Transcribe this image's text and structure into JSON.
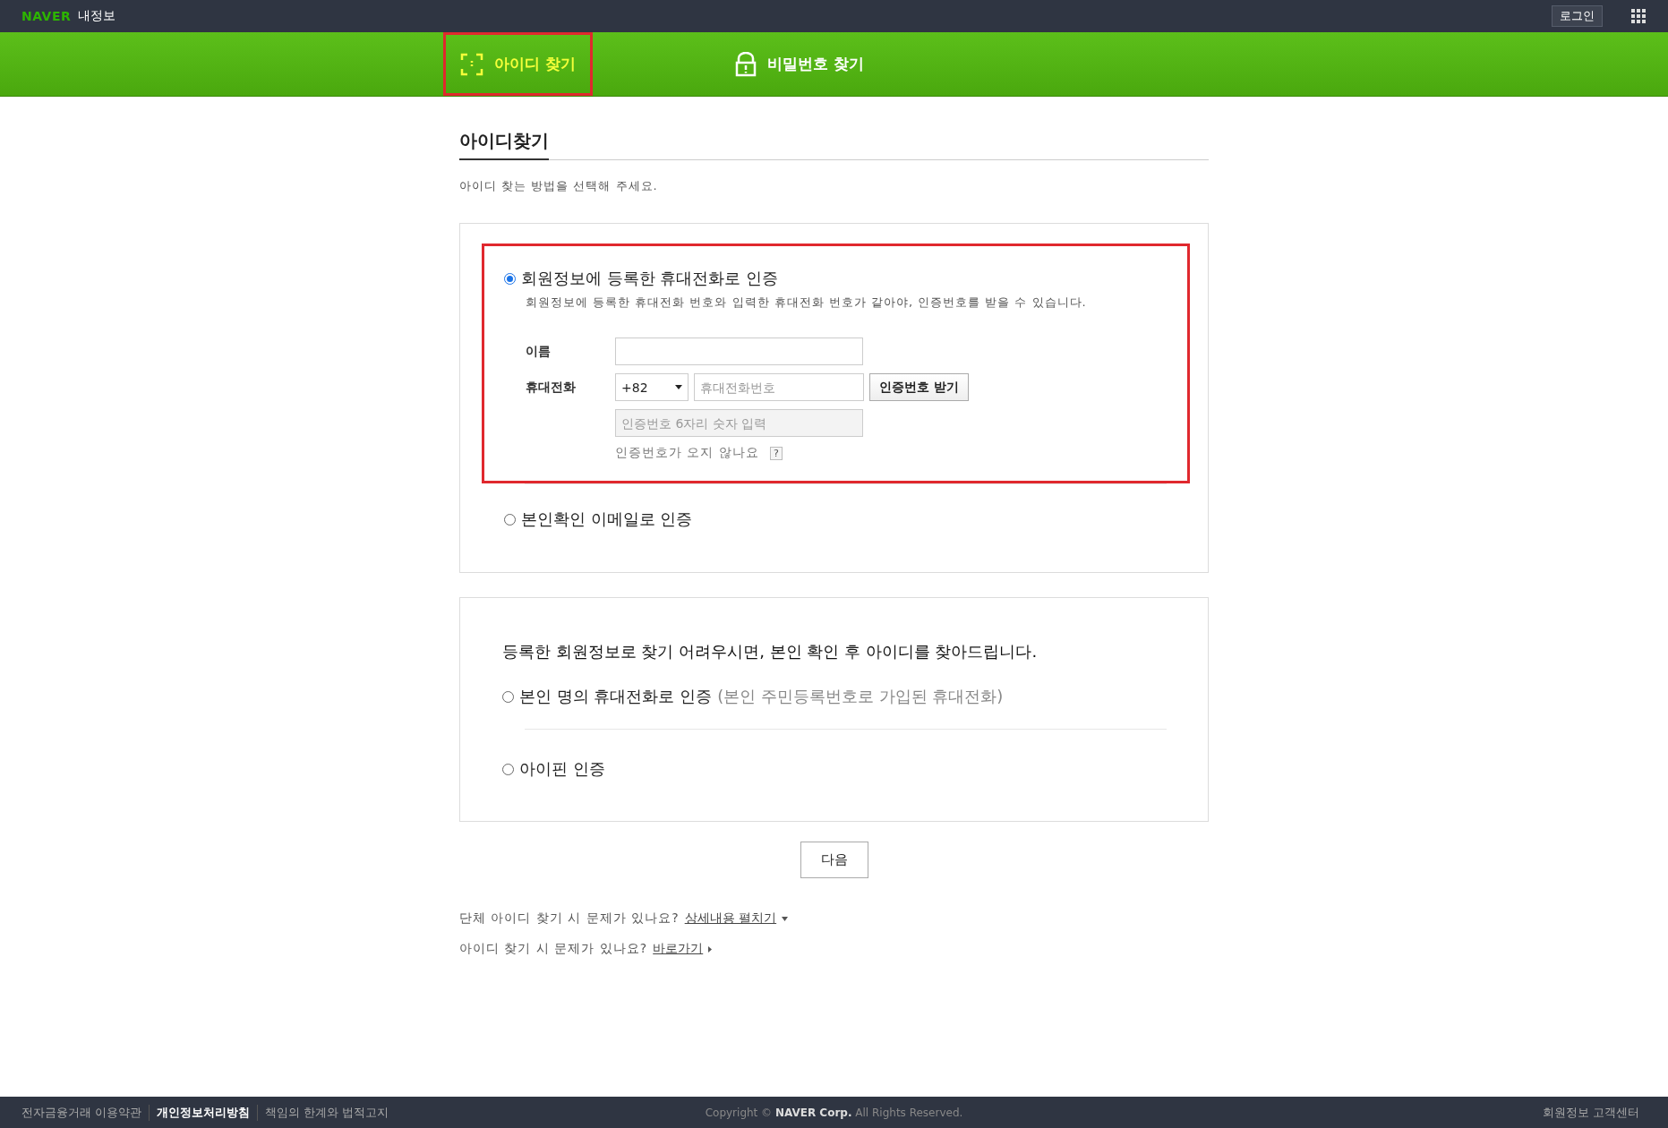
{
  "top_bar": {
    "logo": "NAVER",
    "service": "내정보",
    "login_button": "로그인"
  },
  "nav_tabs": [
    {
      "label": "아이디 찾기",
      "kind": "id",
      "selected": true,
      "highlighted": true
    },
    {
      "label": "비밀번호 찾기",
      "kind": "password",
      "selected": false,
      "highlighted": false
    }
  ],
  "page_title": "아이디찾기",
  "instruction": "아이디 찾는 방법을 선택해 주세요.",
  "primary_options": [
    {
      "label": "회원정보에 등록한 휴대전화로 인증",
      "selected": true,
      "highlighted": true,
      "description": "회원정보에 등록한 휴대전화 번호와 입력한 휴대전화 번호가 같아야, 인증번호를 받을 수 있습니다.",
      "form": {
        "name_label": "이름",
        "phone_label": "휴대전화",
        "country_code": "+82",
        "phone_placeholder": "휴대전화번호",
        "send_code_button": "인증번호 받기",
        "code_placeholder": "인증번호 6자리 숫자 입력",
        "no_code_help": "인증번호가 오지 않나요",
        "help_button": "?"
      }
    },
    {
      "label": "본인확인 이메일로 인증",
      "selected": false,
      "highlighted": false
    }
  ],
  "alternative": {
    "heading": "등록한 회원정보로 찾기 어려우시면, 본인 확인 후 아이디를 찾아드립니다.",
    "options": [
      {
        "label": "본인 명의 휴대전화로 인증",
        "note": "(본인 주민등록번호로 가입된 휴대전화)",
        "selected": false
      },
      {
        "label": "아이핀 인증",
        "selected": false
      }
    ]
  },
  "next_button": "다음",
  "help_lines": [
    {
      "text": "단체 아이디 찾기 시 문제가 있나요?",
      "link": "상세내용 펼치기",
      "kind": "expand"
    },
    {
      "text": "아이디 찾기 시 문제가 있나요?",
      "link": "바로가기",
      "kind": "go"
    }
  ],
  "footer": {
    "links": [
      {
        "label": "전자금융거래 이용약관",
        "bold": false
      },
      {
        "label": "개인정보처리방침",
        "bold": true
      },
      {
        "label": "책임의 한계와 법적고지",
        "bold": false
      }
    ],
    "copyright": "Copyright © **NAVER Corp.** All Rights Reserved.",
    "help_center": "회원정보 고객센터"
  }
}
